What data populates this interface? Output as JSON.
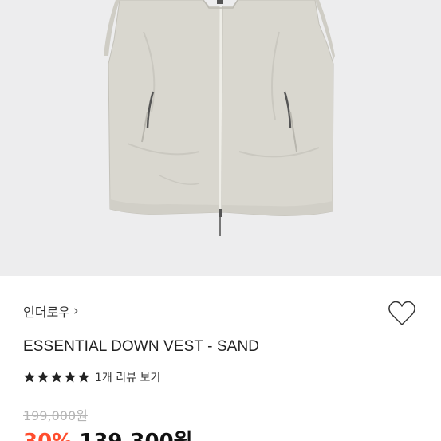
{
  "product": {
    "image_alt": "sand colored padded vest",
    "brand": "인더로우",
    "brand_chevron": "›",
    "name": "ESSENTIAL DOWN VEST - SAND",
    "rating": 5,
    "review_link": "1개 리뷰 보기",
    "original_price": "199,000원",
    "discount": "30%",
    "sale_price": "139,300원"
  },
  "colors": {
    "image_bg": "#ededee",
    "vest": "#d9d7cf",
    "discount": "#ff4d2e",
    "star": "#222222",
    "original_price": "#b4b4b4"
  },
  "icons": {
    "wishlist": "heart-outline-icon",
    "brand_link": "chevron-right-icon",
    "rating": "star-icon"
  }
}
